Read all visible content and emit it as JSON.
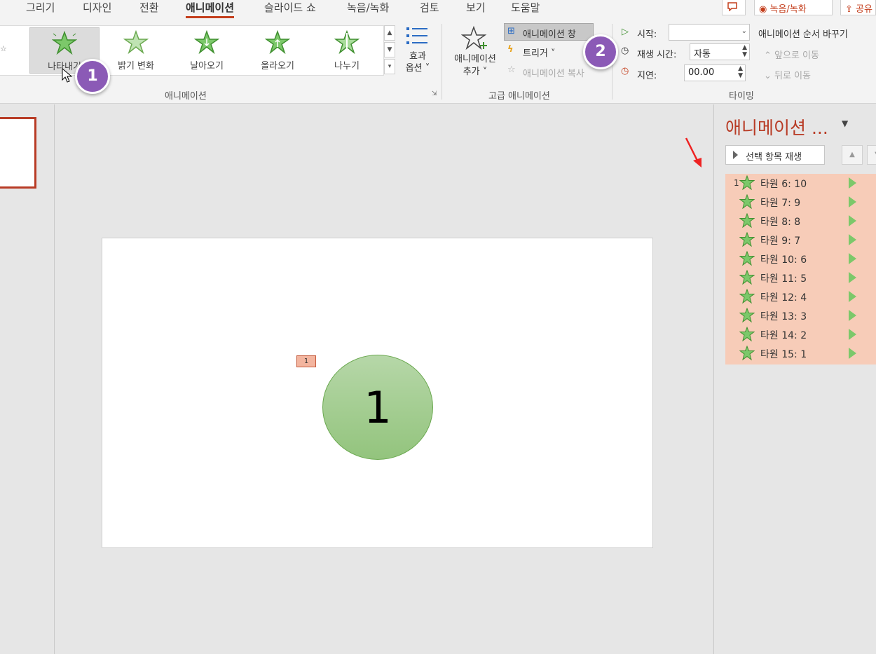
{
  "tabs": [
    "그리기",
    "디자인",
    "전환",
    "애니메이션",
    "슬라이드 쇼",
    "녹음/녹화",
    "검토",
    "보기",
    "도움말"
  ],
  "top_right": {
    "record": "녹음/녹화",
    "share": "공유"
  },
  "gallery": {
    "items": [
      {
        "label": "나타내기",
        "icon": "appear-star-icon"
      },
      {
        "label": "밝기 변화",
        "icon": "fade-star-icon"
      },
      {
        "label": "날아오기",
        "icon": "fly-in-star-icon"
      },
      {
        "label": "올라오기",
        "icon": "float-in-star-icon"
      },
      {
        "label": "나누기",
        "icon": "split-star-icon"
      }
    ],
    "effect_options": [
      "효과",
      "옵션"
    ],
    "group_label": "애니메이션"
  },
  "advanced": {
    "add_animation": [
      "애니메이션",
      "추가"
    ],
    "animation_pane": "애니메이션 창",
    "trigger": "트리거",
    "animation_painter": "애니메이션 복사",
    "group_label": "고급 애니메이션"
  },
  "timing": {
    "start_label": "시작:",
    "start_value": "",
    "duration_label": "재생 시간:",
    "duration_value": "자동",
    "delay_label": "지연:",
    "delay_value": "00.00",
    "reorder_label": "애니메이션 순서 바꾸기",
    "move_earlier": "앞으로 이동",
    "move_later": "뒤로 이동",
    "group_label": "타이밍"
  },
  "badges": [
    "1",
    "2"
  ],
  "slide": {
    "tag": "1",
    "circle_text": "1"
  },
  "pane": {
    "title": "애니메이션 ...",
    "play_button": "선택 항목 재생",
    "items": [
      {
        "num": "1",
        "label": "타원 6: 10"
      },
      {
        "num": "",
        "label": "타원 7: 9"
      },
      {
        "num": "",
        "label": "타원 8: 8"
      },
      {
        "num": "",
        "label": "타원 9: 7"
      },
      {
        "num": "",
        "label": "타원 10: 6"
      },
      {
        "num": "",
        "label": "타원 11: 5"
      },
      {
        "num": "",
        "label": "타원 12: 4"
      },
      {
        "num": "",
        "label": "타원 13: 3"
      },
      {
        "num": "",
        "label": "타원 14: 2"
      },
      {
        "num": "",
        "label": "타원 15: 1"
      }
    ]
  },
  "colors": {
    "accent": "#c43e1c",
    "badge": "#8b5ab6",
    "list_bg": "#f7ccb8",
    "circle": "#93c47d"
  }
}
